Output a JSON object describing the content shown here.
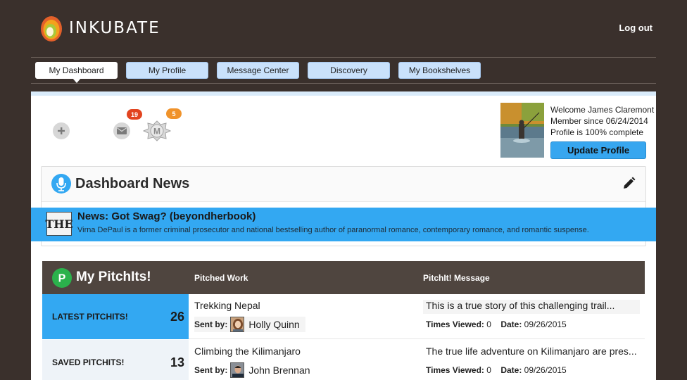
{
  "header": {
    "brand": "INKUBATE",
    "logout_label": "Log out"
  },
  "tabs": [
    {
      "label": "My Dashboard",
      "active": true
    },
    {
      "label": "My Profile",
      "active": false
    },
    {
      "label": "Message Center",
      "active": false
    },
    {
      "label": "Discovery",
      "active": false
    },
    {
      "label": "My Bookshelves",
      "active": false
    }
  ],
  "quick_icons": {
    "add_icon": "plus-icon",
    "messages_badge": "19",
    "messages_icon": "envelope-icon",
    "medal_badge": "5",
    "medal_icon": "medal-icon",
    "medal_letter": "M"
  },
  "profile": {
    "welcome_label": "Welcome",
    "name": "James Claremont",
    "member_since": "Member since 06/24/2014",
    "completion": "Profile is 100% complete",
    "update_label": "Update Profile"
  },
  "news": {
    "title": "Dashboard News",
    "item_logo": "THE",
    "item_title": "News: Got Swag? (beyondherbook)",
    "item_text": "Virna DePaul is a former criminal prosecutor and national bestselling author of paranormal romance, contemporary romance, and romantic suspense."
  },
  "pitchits": {
    "badge_letter": "P",
    "title": "My PitchIts!",
    "col_work": "Pitched Work",
    "col_message": "PitchIt! Message",
    "sent_by_label": "Sent by:",
    "views_label": "Times Viewed:",
    "date_label": "Date:",
    "rows": [
      {
        "side_label": "LATEST PITCHITS!",
        "side_count": "26",
        "work": "Trekking Nepal",
        "sender": "Holly Quinn",
        "message": "This is a true story of  this challenging trail...",
        "views": "0",
        "date": "09/26/2015"
      },
      {
        "side_label": "SAVED PITCHITS!",
        "side_count": "13",
        "work": "Climbing the Kilimanjaro",
        "sender": "John Brennan",
        "message": "The true life adventure on Kilimanjaro are pres...",
        "views": "0",
        "date": "09/26/2015"
      }
    ]
  },
  "colors": {
    "background": "#3a302c",
    "accent_blue": "#33a8f2",
    "tab_blue": "#c9e1fb",
    "badge_red": "#e2441f",
    "badge_orange": "#f0932b",
    "pitch_green": "#2bb24c"
  }
}
